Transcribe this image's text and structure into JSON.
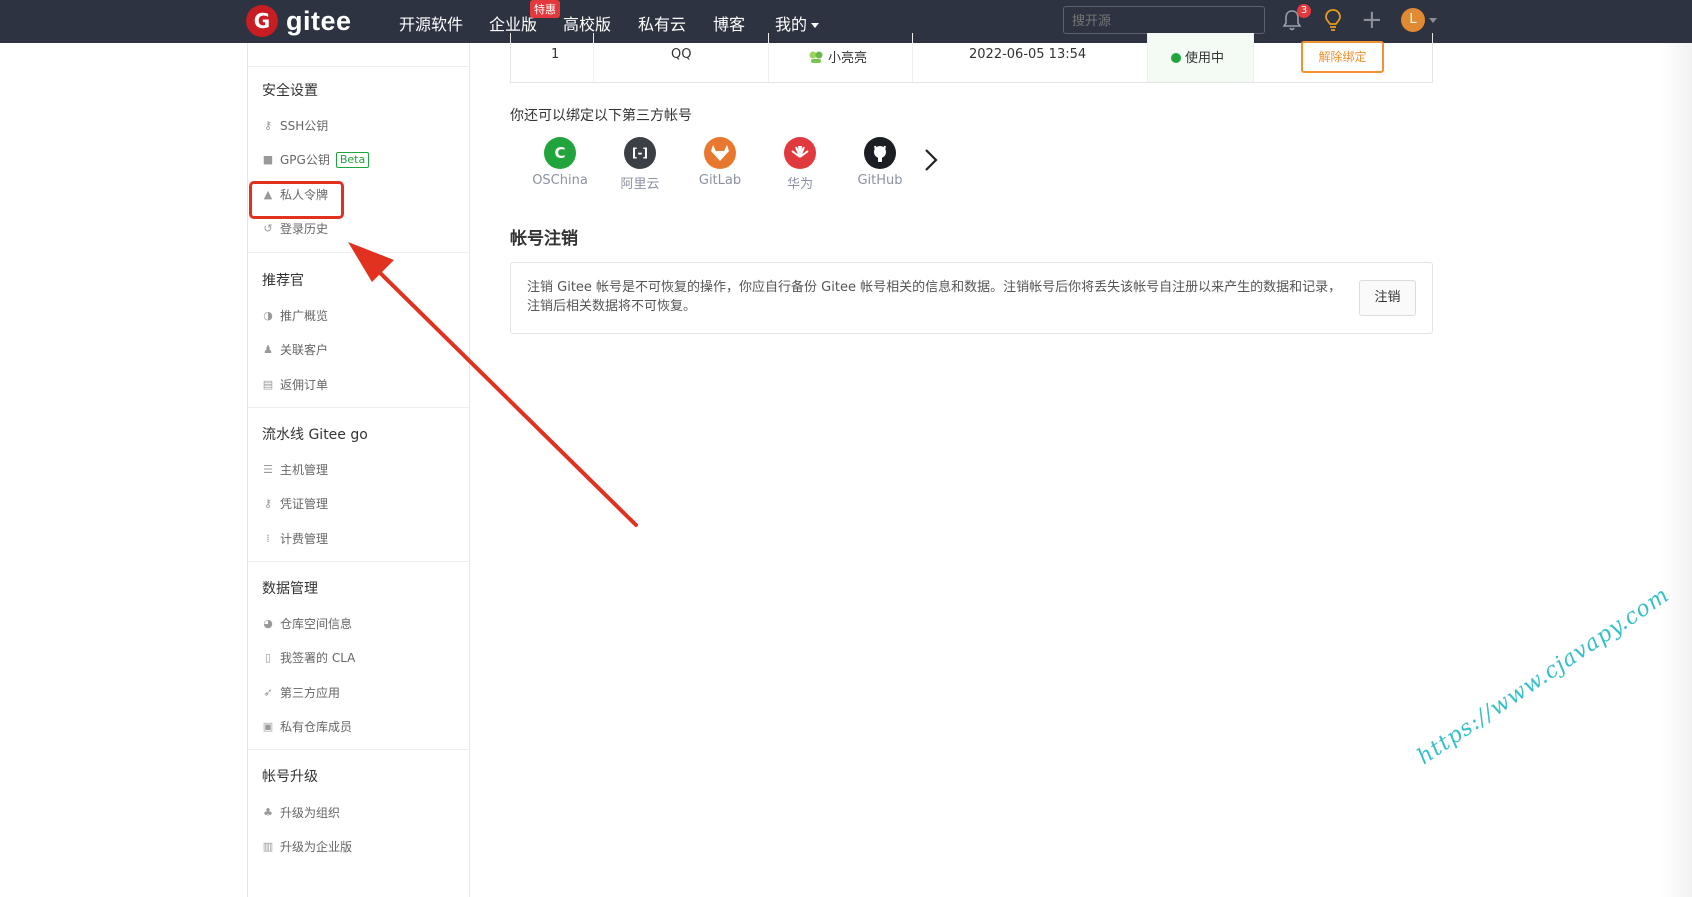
{
  "topbar": {
    "logo_letter": "G",
    "logo_text": "gitee",
    "nav": [
      "开源软件",
      "企业版",
      "高校版",
      "私有云",
      "博客",
      "我的"
    ],
    "enterprise_badge": "特惠",
    "search_placeholder": "搜开源",
    "notification_count": "3",
    "avatar_letter": "L"
  },
  "sidebar": {
    "security": {
      "heading": "安全设置",
      "items": [
        "SSH公钥",
        "GPG公钥",
        "私人令牌",
        "登录历史"
      ],
      "beta": "Beta"
    },
    "referrer": {
      "heading": "推荐官",
      "items": [
        "推广概览",
        "关联客户",
        "返佣订单"
      ]
    },
    "pipeline": {
      "heading": "流水线 Gitee go",
      "items": [
        "主机管理",
        "凭证管理",
        "计费管理"
      ]
    },
    "data": {
      "heading": "数据管理",
      "items": [
        "仓库空间信息",
        "我签署的 CLA",
        "第三方应用",
        "私有仓库成员"
      ]
    },
    "upgrade": {
      "heading": "帐号升级",
      "items": [
        "升级为组织",
        "升级为企业版"
      ]
    }
  },
  "binding_row": {
    "index": "1",
    "platform": "QQ",
    "nickname": "小亮亮",
    "time": "2022-06-05 13:54",
    "status": "使用中",
    "unbind": "解除绑定"
  },
  "bind_more": {
    "title": "你还可以绑定以下第三方帐号",
    "providers": [
      {
        "name": "OSChina",
        "icon": "C",
        "color": "#21a43c"
      },
      {
        "name": "阿里云",
        "icon": "[-]",
        "color": "#3b3f46"
      },
      {
        "name": "GitLab",
        "icon": "gitlab-icon",
        "color": "#e8782f"
      },
      {
        "name": "华为",
        "icon": "huawei-icon",
        "color": "#e0393e"
      },
      {
        "name": "GitHub",
        "icon": "github-icon",
        "color": "#1b1f23"
      }
    ]
  },
  "cancel": {
    "title": "帐号注销",
    "text": "注销 Gitee 帐号是不可恢复的操作，你应自行备份 Gitee 帐号相关的信息和数据。注销帐号后你将丢失该帐号自注册以来产生的数据和记录，注销后相关数据将不可恢复。",
    "button": "注销"
  },
  "watermark": "https://www.cjavapy.com",
  "colors": {
    "topbar": "#2d3340",
    "brand_red": "#c71d23",
    "status_green": "#21a43c",
    "unbind_orange": "#f19130",
    "annotation_red": "#e0321f"
  }
}
